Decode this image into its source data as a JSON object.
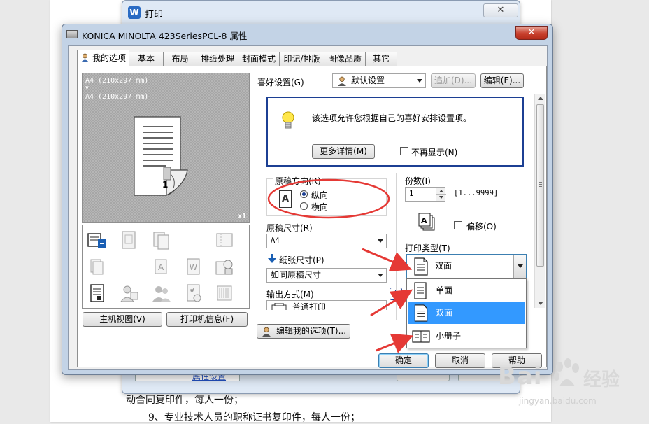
{
  "document": {
    "lines": [
      "动合同复印件，每人一份；",
      "9、专业技术人员的职称证书复印件，每人一份；"
    ]
  },
  "print_dialog": {
    "title": "打印",
    "app_icon_letter": "W",
    "close_glyph": "✕",
    "link_text": "属性设置"
  },
  "properties_dialog": {
    "title": "KONICA MINOLTA 423SeriesPCL-8 属性",
    "close_glyph": "✕",
    "tabs": [
      {
        "label": "我的选项",
        "active": true
      },
      {
        "label": "基本",
        "active": false
      },
      {
        "label": "布局",
        "active": false
      },
      {
        "label": "排纸处理",
        "active": false
      },
      {
        "label": "封面模式",
        "active": false
      },
      {
        "label": "印记/排版",
        "active": false
      },
      {
        "label": "图像品质",
        "active": false
      },
      {
        "label": "其它",
        "active": false
      }
    ],
    "preview": {
      "line1": "A4 (210x297 mm)",
      "arrow": "▼",
      "line2": "A4 (210x297 mm)",
      "page_number": "1",
      "copies_badge": "x1"
    },
    "left_buttons": {
      "main_view": "主机视图(V)",
      "printer_info": "打印机信息(F)"
    },
    "favorites": {
      "label": "喜好设置(G)",
      "value": "默认设置",
      "add_button": "追加(D)...",
      "edit_button": "编辑(E)..."
    },
    "info": {
      "message": "该选项允许您根据自己的喜好安排设置项。",
      "more_button": "更多详情(M)",
      "dont_show_label": "不再显示(N)"
    },
    "orientation": {
      "label": "原稿方向(R)",
      "icon_letter": "A",
      "options": [
        {
          "label": "纵向",
          "selected": true
        },
        {
          "label": "横向",
          "selected": false
        }
      ]
    },
    "original_size": {
      "label": "原稿尺寸(R)",
      "value": "A4"
    },
    "paper_size": {
      "label": "纸张尺寸(P)",
      "value": "如同原稿尺寸"
    },
    "output_method": {
      "label": "输出方式(M)",
      "value": "普通打印",
      "info_glyph": "i"
    },
    "copies": {
      "label": "份数(I)",
      "value": "1",
      "range": "[1...9999]"
    },
    "offset": {
      "label": "偏移(O)"
    },
    "print_type": {
      "label": "打印类型(T)",
      "value": "双面",
      "options": [
        {
          "label": "单面",
          "selected": false
        },
        {
          "label": "双面",
          "selected": true
        },
        {
          "label": "小册子",
          "selected": false
        }
      ]
    },
    "edit_my_options_button": "编辑我的选项(T)...",
    "footer": {
      "ok": "确定",
      "cancel": "取消",
      "help": "帮助"
    }
  },
  "watermark": {
    "brand": "Bai",
    "brand_cn": "经验",
    "url": "jingyan.baidu.com"
  },
  "colors": {
    "annotation_red": "#e53935",
    "accent_blue": "#1c3f93",
    "selection": "#3399ff"
  }
}
